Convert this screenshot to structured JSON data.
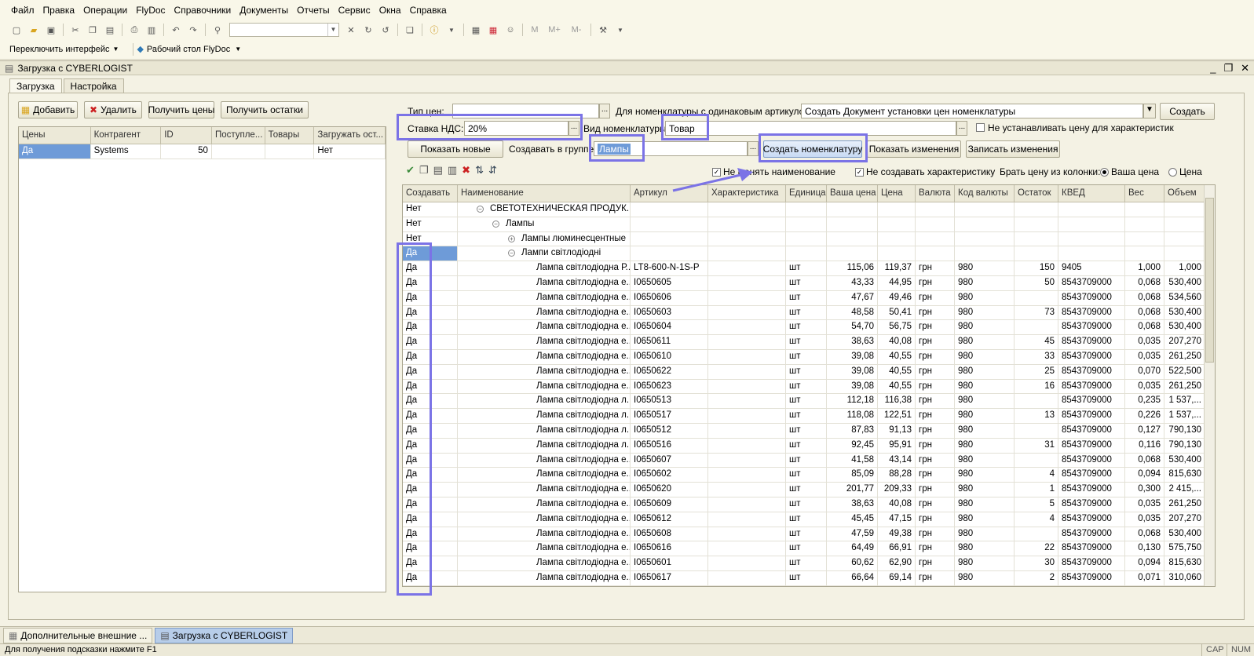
{
  "menu": [
    "Файл",
    "Правка",
    "Операции",
    "FlyDoc",
    "Справочники",
    "Документы",
    "Отчеты",
    "Сервис",
    "Окна",
    "Справка"
  ],
  "toolbar2": {
    "switch_interface": "Переключить интерфейс",
    "desktop": "Рабочий стол FlyDoc"
  },
  "window": {
    "title": "Загрузка с CYBERLOGIST"
  },
  "tabs": [
    "Загрузка",
    "Настройка"
  ],
  "left_buttons": {
    "add": "Добавить",
    "delete": "Удалить",
    "get_prices": "Получить цены",
    "get_stock": "Получить остатки"
  },
  "left_grid": {
    "columns": [
      "Цены",
      "Контрагент",
      "ID",
      "Поступле...",
      "Товары",
      "Загружать ост..."
    ],
    "rows": [
      {
        "c0": "Да",
        "c1": "Systems",
        "c2": "50",
        "c3": "",
        "c4": "",
        "c5": "Нет"
      }
    ]
  },
  "form": {
    "price_type_label": "Тип цен:",
    "price_type_value": "",
    "same_article_label": "Для номенклатуры с одинаковым артикулом:",
    "same_article_value": "Создать Документ установки цен номенклатуры",
    "create_button": "Создать",
    "vat_label": "Ставка НДС:",
    "vat_value": "20%",
    "nom_kind_label": "Вид номенклатуры:",
    "nom_kind_value": "Товар",
    "no_price_for_char_label": "Не устанавливать цену для характеристик",
    "show_new_button": "Показать новые",
    "create_in_group_label": "Создавать в группе:",
    "create_in_group_value": "Лампы",
    "create_nom_button": "Создать номенклатуру",
    "show_changes_button": "Показать изменения",
    "write_changes_button": "Записать изменения",
    "no_change_name_label": "Не менять наименование",
    "no_create_char_label": "Не создавать характеристику",
    "take_price_label": "Брать цену из колонки:",
    "your_price_label": "Ваша цена",
    "price_label": "Цена"
  },
  "main_grid": {
    "columns": [
      "Создавать",
      "Наименование",
      "Артикул",
      "Характеристика",
      "Единица",
      "Ваша цена",
      "Цена",
      "Валюта",
      "Код валюты",
      "Остаток",
      "КВЕД",
      "Вес",
      "Объем"
    ],
    "group_rows": [
      {
        "create": "Нет",
        "name": "СВЕТОТЕХНИЧЕСКАЯ ПРОДУК...",
        "icon": "collapse-icon"
      },
      {
        "create": "Нет",
        "name": "Лампы",
        "icon": "collapse-icon"
      },
      {
        "create": "Нет",
        "name": "Лампы люминесцентные",
        "icon": "expand-icon"
      },
      {
        "create": "Да",
        "name": "Лампи світлодіодні",
        "icon": "collapse-icon"
      }
    ],
    "item_rows": [
      {
        "create": "Да",
        "name": "Лампа світлодіодна Р...",
        "article": "LT8-600-N-1S-P",
        "char": "",
        "unit": "шт",
        "your_price": "115,06",
        "price": "119,37",
        "currency": "грн",
        "code": "980",
        "stock": "150",
        "kved": "9405",
        "weight": "1,000",
        "volume": "1,000"
      },
      {
        "create": "Да",
        "name": "Лампа світлодіодна е...",
        "article": "I0650605",
        "char": "",
        "unit": "шт",
        "your_price": "43,33",
        "price": "44,95",
        "currency": "грн",
        "code": "980",
        "stock": "50",
        "kved": "8543709000",
        "weight": "0,068",
        "volume": "530,400"
      },
      {
        "create": "Да",
        "name": "Лампа світлодіодна е...",
        "article": "I0650606",
        "char": "",
        "unit": "шт",
        "your_price": "47,67",
        "price": "49,46",
        "currency": "грн",
        "code": "980",
        "stock": "",
        "kved": "8543709000",
        "weight": "0,068",
        "volume": "534,560"
      },
      {
        "create": "Да",
        "name": "Лампа світлодіодна е...",
        "article": "I0650603",
        "char": "",
        "unit": "шт",
        "your_price": "48,58",
        "price": "50,41",
        "currency": "грн",
        "code": "980",
        "stock": "73",
        "kved": "8543709000",
        "weight": "0,068",
        "volume": "530,400"
      },
      {
        "create": "Да",
        "name": "Лампа світлодіодна е...",
        "article": "I0650604",
        "char": "",
        "unit": "шт",
        "your_price": "54,70",
        "price": "56,75",
        "currency": "грн",
        "code": "980",
        "stock": "",
        "kved": "8543709000",
        "weight": "0,068",
        "volume": "530,400"
      },
      {
        "create": "Да",
        "name": "Лампа світлодіодна е...",
        "article": "I0650611",
        "char": "",
        "unit": "шт",
        "your_price": "38,63",
        "price": "40,08",
        "currency": "грн",
        "code": "980",
        "stock": "45",
        "kved": "8543709000",
        "weight": "0,035",
        "volume": "207,270"
      },
      {
        "create": "Да",
        "name": "Лампа світлодіодна е...",
        "article": "I0650610",
        "char": "",
        "unit": "шт",
        "your_price": "39,08",
        "price": "40,55",
        "currency": "грн",
        "code": "980",
        "stock": "33",
        "kved": "8543709000",
        "weight": "0,035",
        "volume": "261,250"
      },
      {
        "create": "Да",
        "name": "Лампа світлодіодна е...",
        "article": "I0650622",
        "char": "",
        "unit": "шт",
        "your_price": "39,08",
        "price": "40,55",
        "currency": "грн",
        "code": "980",
        "stock": "25",
        "kved": "8543709000",
        "weight": "0,070",
        "volume": "522,500"
      },
      {
        "create": "Да",
        "name": "Лампа світлодіодна е...",
        "article": "I0650623",
        "char": "",
        "unit": "шт",
        "your_price": "39,08",
        "price": "40,55",
        "currency": "грн",
        "code": "980",
        "stock": "16",
        "kved": "8543709000",
        "weight": "0,035",
        "volume": "261,250"
      },
      {
        "create": "Да",
        "name": "Лампа світлодіодна л...",
        "article": "I0650513",
        "char": "",
        "unit": "шт",
        "your_price": "112,18",
        "price": "116,38",
        "currency": "грн",
        "code": "980",
        "stock": "",
        "kved": "8543709000",
        "weight": "0,235",
        "volume": "1 537,..."
      },
      {
        "create": "Да",
        "name": "Лампа світлодіодна л...",
        "article": "I0650517",
        "char": "",
        "unit": "шт",
        "your_price": "118,08",
        "price": "122,51",
        "currency": "грн",
        "code": "980",
        "stock": "13",
        "kved": "8543709000",
        "weight": "0,226",
        "volume": "1 537,..."
      },
      {
        "create": "Да",
        "name": "Лампа світлодіодна л...",
        "article": "I0650512",
        "char": "",
        "unit": "шт",
        "your_price": "87,83",
        "price": "91,13",
        "currency": "грн",
        "code": "980",
        "stock": "",
        "kved": "8543709000",
        "weight": "0,127",
        "volume": "790,130"
      },
      {
        "create": "Да",
        "name": "Лампа світлодіодна л...",
        "article": "I0650516",
        "char": "",
        "unit": "шт",
        "your_price": "92,45",
        "price": "95,91",
        "currency": "грн",
        "code": "980",
        "stock": "31",
        "kved": "8543709000",
        "weight": "0,116",
        "volume": "790,130"
      },
      {
        "create": "Да",
        "name": "Лампа світлодіодна е...",
        "article": "I0650607",
        "char": "",
        "unit": "шт",
        "your_price": "41,58",
        "price": "43,14",
        "currency": "грн",
        "code": "980",
        "stock": "",
        "kved": "8543709000",
        "weight": "0,068",
        "volume": "530,400"
      },
      {
        "create": "Да",
        "name": "Лампа світлодіодна е...",
        "article": "I0650602",
        "char": "",
        "unit": "шт",
        "your_price": "85,09",
        "price": "88,28",
        "currency": "грн",
        "code": "980",
        "stock": "4",
        "kved": "8543709000",
        "weight": "0,094",
        "volume": "815,630"
      },
      {
        "create": "Да",
        "name": "Лампа світлодіодна е...",
        "article": "I0650620",
        "char": "",
        "unit": "шт",
        "your_price": "201,77",
        "price": "209,33",
        "currency": "грн",
        "code": "980",
        "stock": "1",
        "kved": "8543709000",
        "weight": "0,300",
        "volume": "2 415,..."
      },
      {
        "create": "Да",
        "name": "Лампа світлодіодна е...",
        "article": "I0650609",
        "char": "",
        "unit": "шт",
        "your_price": "38,63",
        "price": "40,08",
        "currency": "грн",
        "code": "980",
        "stock": "5",
        "kved": "8543709000",
        "weight": "0,035",
        "volume": "261,250"
      },
      {
        "create": "Да",
        "name": "Лампа світлодіодна е...",
        "article": "I0650612",
        "char": "",
        "unit": "шт",
        "your_price": "45,45",
        "price": "47,15",
        "currency": "грн",
        "code": "980",
        "stock": "4",
        "kved": "8543709000",
        "weight": "0,035",
        "volume": "207,270"
      },
      {
        "create": "Да",
        "name": "Лампа світлодіодна е...",
        "article": "I0650608",
        "char": "",
        "unit": "шт",
        "your_price": "47,59",
        "price": "49,38",
        "currency": "грн",
        "code": "980",
        "stock": "",
        "kved": "8543709000",
        "weight": "0,068",
        "volume": "530,400"
      },
      {
        "create": "Да",
        "name": "Лампа світлодіодна е...",
        "article": "I0650616",
        "char": "",
        "unit": "шт",
        "your_price": "64,49",
        "price": "66,91",
        "currency": "грн",
        "code": "980",
        "stock": "22",
        "kved": "8543709000",
        "weight": "0,130",
        "volume": "575,750"
      },
      {
        "create": "Да",
        "name": "Лампа світлодіодна е...",
        "article": "I0650601",
        "char": "",
        "unit": "шт",
        "your_price": "60,62",
        "price": "62,90",
        "currency": "грн",
        "code": "980",
        "stock": "30",
        "kved": "8543709000",
        "weight": "0,094",
        "volume": "815,630"
      },
      {
        "create": "Да",
        "name": "Лампа світлодіодна е...",
        "article": "I0650617",
        "char": "",
        "unit": "шт",
        "your_price": "66,64",
        "price": "69,14",
        "currency": "грн",
        "code": "980",
        "stock": "2",
        "kved": "8543709000",
        "weight": "0,071",
        "volume": "310,060"
      }
    ]
  },
  "taskbar": [
    "Дополнительные внешние ...",
    "Загрузка с CYBERLOGIST"
  ],
  "status": {
    "hint": "Для получения подсказки нажмите F1",
    "cap": "CAP",
    "num": "NUM"
  },
  "colors": {
    "highlight": "#7b73e6",
    "selection": "#6e9bd8"
  }
}
